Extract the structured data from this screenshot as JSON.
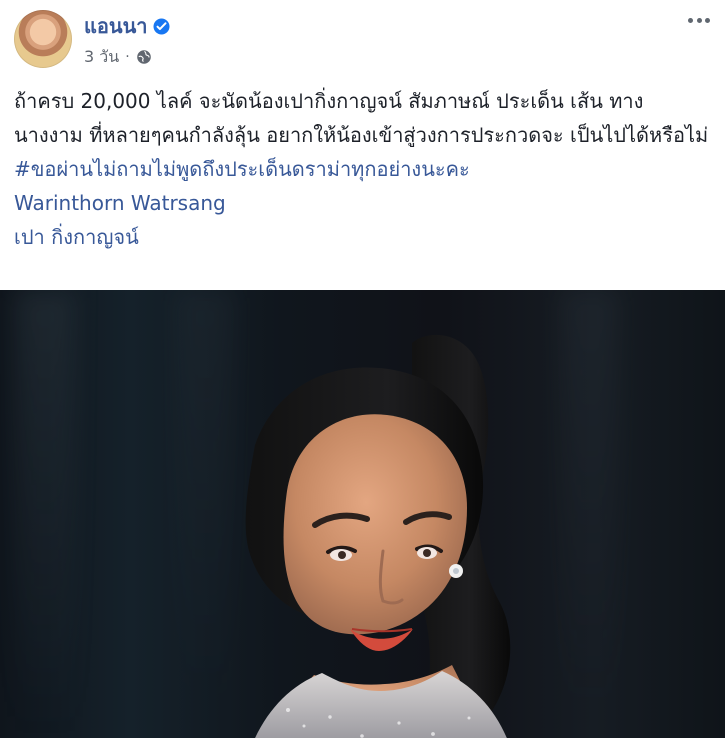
{
  "author": {
    "name": "แอนนา"
  },
  "post": {
    "time": "3 วัน",
    "separator": "·",
    "paragraph1": "ถ้าครบ 20,000 ไลค์ จะนัดน้องเปากิ่งกาญจน์ สัมภาษณ์ ประเด็น เส้น ทางนางงาม ที่หลายๆคนกำลังลุ้น อยากให้น้องเข้าสู่วงการประกวดจะ เป็นไปได้หรือไม่",
    "hashtag": "#ขอผ่านไม่ถามไม่พูดถึงประเด็นดราม่าทุกอย่างนะคะ",
    "mention1": "Warinthorn Watrsang",
    "mention2": "เปา กิ่งกาญจน์"
  },
  "colors": {
    "link": "#385898",
    "text": "#1d2129",
    "meta": "#616770"
  },
  "icons": {
    "verified": "verified-badge-icon",
    "privacy": "globe-icon",
    "more": "more-options-icon"
  }
}
